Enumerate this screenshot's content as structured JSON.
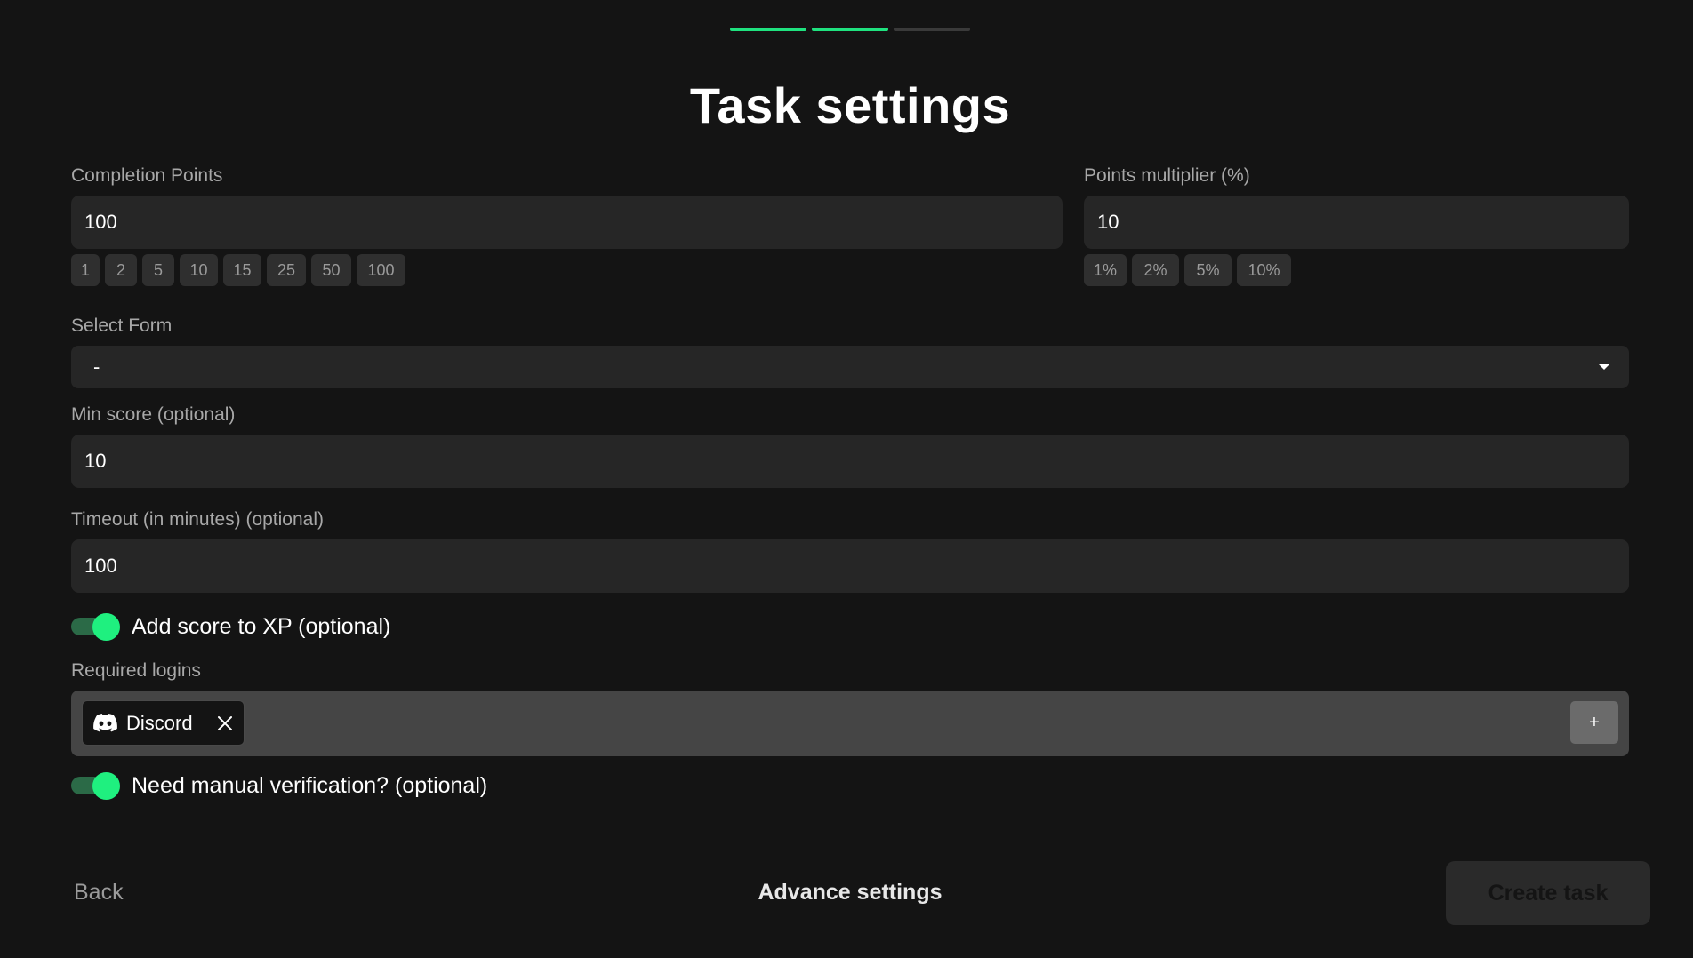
{
  "progress": {
    "steps_total": 3,
    "steps_completed": 2,
    "accent_color": "#1fe27f"
  },
  "page_title": "Task settings",
  "completion_points": {
    "label": "Completion Points",
    "value": "100",
    "presets": [
      "1",
      "2",
      "5",
      "10",
      "15",
      "25",
      "50",
      "100"
    ]
  },
  "points_multiplier": {
    "label": "Points multiplier (%)",
    "value": "10",
    "presets": [
      "1%",
      "2%",
      "5%",
      "10%"
    ]
  },
  "select_form": {
    "label": "Select Form",
    "value": "-",
    "icon": "caret-down-icon"
  },
  "min_score": {
    "label": "Min score (optional)",
    "value": "10"
  },
  "timeout": {
    "label": "Timeout (in minutes) (optional)",
    "value": "100"
  },
  "add_score_toggle": {
    "label": "Add score to XP (optional)",
    "on": true
  },
  "required_logins": {
    "label": "Required logins",
    "items": [
      {
        "name": "Discord",
        "icon": "discord-icon"
      }
    ],
    "add_label": "+"
  },
  "manual_verification_toggle": {
    "label": "Need manual verification? (optional)",
    "on": true
  },
  "footer": {
    "back_label": "Back",
    "advance_label": "Advance settings",
    "create_label": "Create task"
  }
}
